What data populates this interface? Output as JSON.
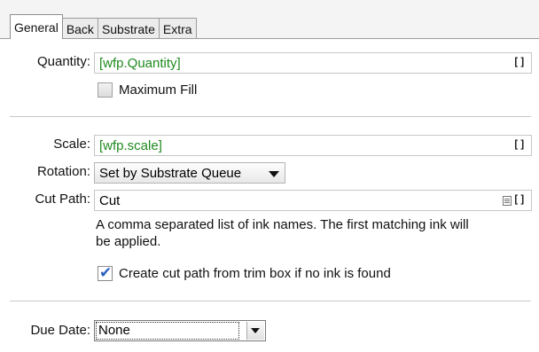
{
  "tabs": [
    "General",
    "Back",
    "Substrate",
    "Extra"
  ],
  "active_tab": "General",
  "quantity": {
    "label": "Quantity:",
    "value": "[wfp.Quantity]",
    "bracket": "[]"
  },
  "max_fill": {
    "label": "Maximum Fill",
    "checked": false
  },
  "scale": {
    "label": "Scale:",
    "value": "[wfp.scale]",
    "bracket": "[]"
  },
  "rotation": {
    "label": "Rotation:",
    "value": "Set by Substrate Queue"
  },
  "cut_path": {
    "label": "Cut Path:",
    "value": "Cut",
    "bracket": "[]",
    "help_line1": "A comma separated list of ink names. The first matching ink will",
    "help_line2": "be applied."
  },
  "trim_box": {
    "label": "Create cut path from trim box if no ink is found",
    "checked": true
  },
  "due_date": {
    "label": "Due Date:",
    "value": "None"
  },
  "colors": {
    "variable_text": "#1f8a1f",
    "check": "#2b5fbf"
  }
}
